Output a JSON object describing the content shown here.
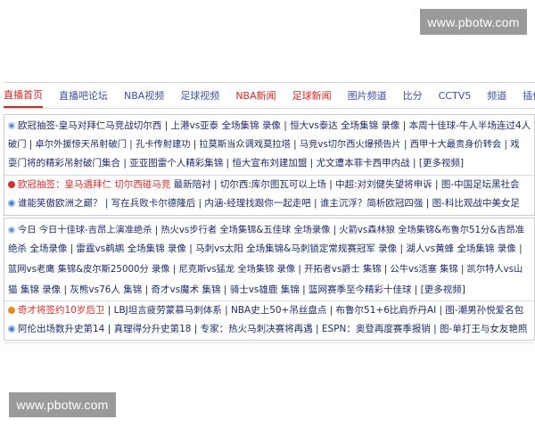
{
  "watermark": {
    "top": "www.pbotw.com",
    "bottom": "www.pbotw.com"
  },
  "nav": {
    "items": [
      {
        "label": "直播首页",
        "color": "red",
        "active": true
      },
      {
        "label": "直播吧论坛",
        "color": "blue"
      },
      {
        "label": "NBA视频",
        "color": "blue"
      },
      {
        "label": "足球视频",
        "color": "blue"
      },
      {
        "label": "NBA新闻",
        "color": "red"
      },
      {
        "label": "足球新闻",
        "color": "red"
      },
      {
        "label": "图片频道",
        "color": "blue"
      },
      {
        "label": "比分",
        "color": "blue"
      },
      {
        "label": "CCTV5",
        "color": "blue"
      },
      {
        "label": "频道",
        "color": "blue"
      },
      {
        "label": "插件",
        "color": "blue"
      }
    ]
  },
  "panel1": {
    "lines": [
      "欧冠抽签-皇马对拜仁马竞战切尔西 | 上港vs亚泰 全场集锦 录像 | 恒大vs泰达 全场集锦 录像 | 本周十佳球-牛人半场连过4人",
      "破门 | 卓尔外援惊天吊射破门 | 孔卡传射建功 | 拉莫斯当众调戏莫拉塔 | 马竞vs切尔西火爆预告片 | 西甲十大最贵身价转会 | 戏",
      "耍门将的精彩吊射破门集合 | 亚亚图雷个人精彩集锦 | 恒大宣布刘建加盟 | 尤文遭本菲卡西甲内战 | [更多视频]",
      "欧冠抽签：皇马遇拜仁 切尔西碰马竞",
      " 最新陪衬 | 切尔西:库尔图瓦可以上场 | 中超:对刘健失望将申诉 | 图-中国足坛黑社会",
      "谁能笑傲欧洲之巅？ | 写在兵败卡尔德隆后 | 内涵-经理找跟你一起走吧 | 谁主沉浮？简析欧冠四强 | 图-科比观战中美女足"
    ]
  },
  "panel2": {
    "lines": [
      "今日 今日十佳球-吉昂上演准绝杀 | 热火vs步行者 全场集锦&五佳球 全场录像 | 火箭vs森林狼 全场集锦&布鲁尔51分&吉昂准",
      "绝杀 全场录像 | 雷霆vs鹈鹕 全场集锦 录像 | 马刺vs太阳 全场集锦&马刺锁定常规赛冠军 录像 | 湖人vs黄蜂 全场集锦 录像 |",
      "篮网vs老鹰 集锦&皮尔斯25000分 录像 | 尼克斯vs猛龙 全场集锦 录像 | 开拓者vs爵士 集锦 | 公牛vs活塞 集锦 | 凯尔特人vs山",
      "猫 集锦 录像 | 灰熊vs76人 集锦 | 奇才vs魔术 集锦 | 骑士vs雄鹿 集锦 | 篮网赛季至今精彩十佳球 | [更多视频]",
      "奇才将签约10岁后卫",
      " | LBJ坦言疲劳蒙慕马刺体系 | NBA史上50+吊丝盘点 | 布鲁尔51+6比肩乔丹AI | 图-潮男孙悦爱名包",
      "阿伦出场数升史第14 | 真理得分升史第18 | 专家：热火马刺决赛将再遇 | ESPN：奥登再度赛季报销 | 图-单打王与女友艳照"
    ]
  }
}
